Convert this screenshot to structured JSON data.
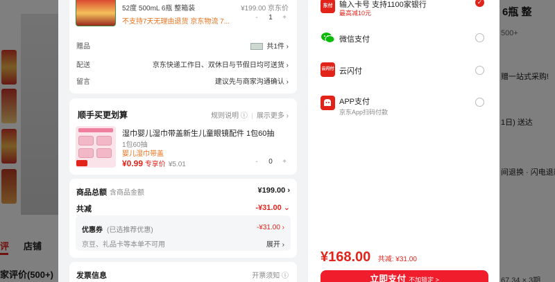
{
  "background_page": {
    "tab_review": "评",
    "tab_store": "店铺",
    "review_heading": "家评价(500+)",
    "title_fragment": "6瓶 整",
    "sub_fragment": "500+",
    "gift_fragment": "赠一站式采购!",
    "ship_fragment": "1日) 送达",
    "return_fragment": "间退换 · 闪电退款",
    "dims_fragment": "67.34 × 3期"
  },
  "product": {
    "spec": "52度 500mL 6瓶 整箱装",
    "price": "¥199.00 京东价",
    "notice": "不支持7天无理由退货  京东物流  7...",
    "quantity": "1",
    "minus": "-",
    "plus": "+"
  },
  "order_rows": [
    {
      "label": "赠品",
      "value": "共1件 ›"
    },
    {
      "label": "配送",
      "value": "京东快递工作日、双休日与节假日均可送货 ›"
    },
    {
      "label": "留言",
      "value": "建议先与商家沟通确认 ›"
    }
  ],
  "addon": {
    "title": "顺手买更划算",
    "rules_link": "规则说明 ⓘ",
    "more_link": "展示更多 ›",
    "item_name": "湿巾婴儿湿巾带盖新生儿童眼镜配件 1包60抽",
    "item_spec": "1包60抽",
    "item_tag": "婴儿湿巾带盖",
    "item_price": "¥0.99",
    "item_price_tag": "专享价",
    "item_orig_price": "¥5.01",
    "quantity": "0",
    "minus": "-",
    "plus": "+"
  },
  "totals": {
    "goods_label": "商品总额",
    "goods_hint": "含商品金额",
    "goods_value": "¥199.00 ›",
    "discount_label": "共减",
    "discount_value": "-¥31.00 ⌄",
    "coupon_label": "优惠券",
    "coupon_hint": "(已选推荐优惠)",
    "coupon_value": "-¥31.00 ›",
    "card_note": "京豆、礼品卡等本单不可用",
    "expand": "展开 ›"
  },
  "invoice": {
    "title": "发票信息",
    "link": "开票须知 ⓘ"
  },
  "payments": [
    {
      "name": "输入卡号 支持1100家银行",
      "sub": "最高减10元",
      "icon": "jd-pay-icon",
      "icon_text": "东付",
      "selected": true
    },
    {
      "name": "微信支付",
      "sub": "",
      "icon": "wechat-pay-icon",
      "icon_text": "",
      "selected": false
    },
    {
      "name": "云闪付",
      "sub": "",
      "icon": "unionpay-icon",
      "icon_text": "云闪付",
      "selected": false
    },
    {
      "name": "APP支付",
      "sub": "京东App扫码付款",
      "icon": "jd-app-icon",
      "icon_text": "",
      "selected": false
    }
  ],
  "summary": {
    "amount": "¥168.00",
    "discount": "共减: ¥31.00",
    "pay_button": "立即支付",
    "pay_button_sub": "不加锁定 >"
  },
  "colors": {
    "accent": "#e2231a",
    "button": "#f01e2c",
    "wechat_green": "#09bb07"
  }
}
